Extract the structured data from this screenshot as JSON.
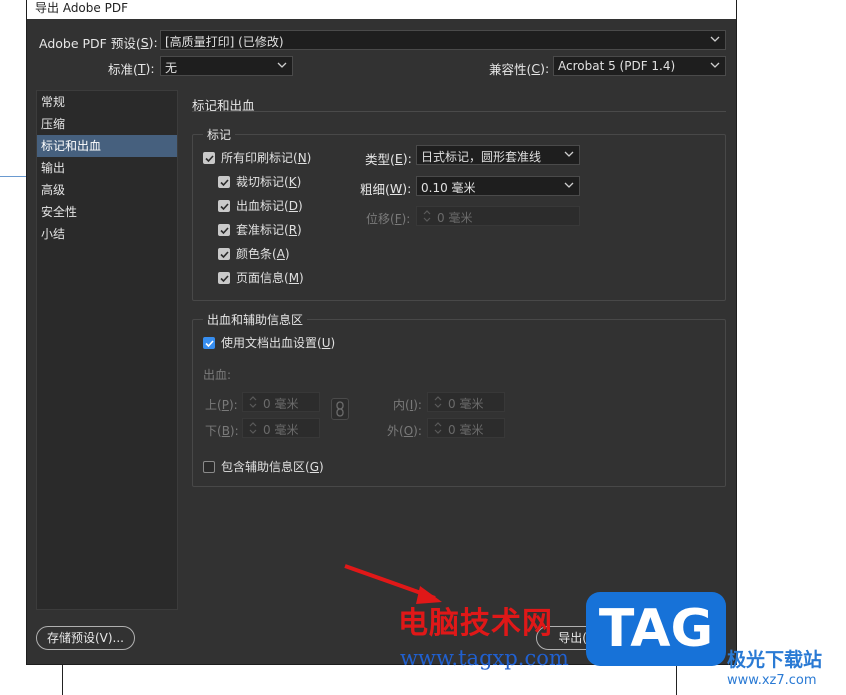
{
  "window": {
    "title": "导出 Adobe PDF"
  },
  "preset": {
    "label": "Adobe PDF 预设(",
    "key": "S",
    "label_end": "):",
    "value": "[高质量打印] (已修改)"
  },
  "standard": {
    "label": "标准(",
    "key": "T",
    "label_end": "):",
    "value": "无"
  },
  "compat": {
    "label": "兼容性(",
    "key": "C",
    "label_end": "):",
    "value": "Acrobat 5 (PDF 1.4)"
  },
  "sidebar": {
    "items": [
      {
        "label": "常规",
        "selected": false
      },
      {
        "label": "压缩",
        "selected": false
      },
      {
        "label": "标记和出血",
        "selected": true
      },
      {
        "label": "输出",
        "selected": false
      },
      {
        "label": "高级",
        "selected": false
      },
      {
        "label": "安全性",
        "selected": false
      },
      {
        "label": "小结",
        "selected": false
      }
    ]
  },
  "main": {
    "section_title": "标记和出血",
    "marks": {
      "group_title": "标记",
      "all_marks": {
        "label": "所有印刷标记(",
        "key": "N",
        "label_end": ")",
        "checked": true
      },
      "items": [
        {
          "label": "裁切标记(",
          "key": "K",
          "label_end": ")",
          "checked": true
        },
        {
          "label": "出血标记(",
          "key": "D",
          "label_end": ")",
          "checked": true
        },
        {
          "label": "套准标记(",
          "key": "R",
          "label_end": ")",
          "checked": true
        },
        {
          "label": "颜色条(",
          "key": "A",
          "label_end": ")",
          "checked": true
        },
        {
          "label": "页面信息(",
          "key": "M",
          "label_end": ")",
          "checked": true
        }
      ],
      "type": {
        "label": "类型(",
        "key": "E",
        "label_end": "):",
        "value": "日式标记，圆形套准线"
      },
      "weight": {
        "label": "粗细(",
        "key": "W",
        "label_end": "):",
        "value": "0.10 毫米"
      },
      "offset": {
        "label": "位移(",
        "key": "F",
        "label_end": "):",
        "value": "0 毫米"
      }
    },
    "bleed": {
      "group_title": "出血和辅助信息区",
      "use_doc": {
        "label": "使用文档出血设置(",
        "key": "U",
        "label_end": ")",
        "checked": true
      },
      "bleed_label": "出血:",
      "top": {
        "label": "上(",
        "key": "P",
        "label_end": "):",
        "value": "0 毫米"
      },
      "bottom": {
        "label": "下(",
        "key": "B",
        "label_end": "):",
        "value": "0 毫米"
      },
      "inside": {
        "label": "内(",
        "key": "I",
        "label_end": "):",
        "value": "0 毫米"
      },
      "outside": {
        "label": "外(",
        "key": "O",
        "label_end": "):",
        "value": "0 毫米"
      },
      "slug": {
        "label": "包含辅助信息区(",
        "key": "G",
        "label_end": ")",
        "checked": false
      }
    }
  },
  "footer": {
    "save_preset": "存储预设(V)...",
    "export": "导出(X)"
  },
  "watermark": {
    "site_name": "电脑技术网",
    "url": "www.tagxp.com",
    "tag": "TAG",
    "brand": "极光下载站",
    "brand_url": "www.xz7.com"
  },
  "colors": {
    "dialog_bg": "#323232",
    "selected_bg": "#46607e",
    "checkbox_blue": "#378ef0",
    "watermark_red": "#e01818",
    "watermark_blue": "#1772d8"
  }
}
